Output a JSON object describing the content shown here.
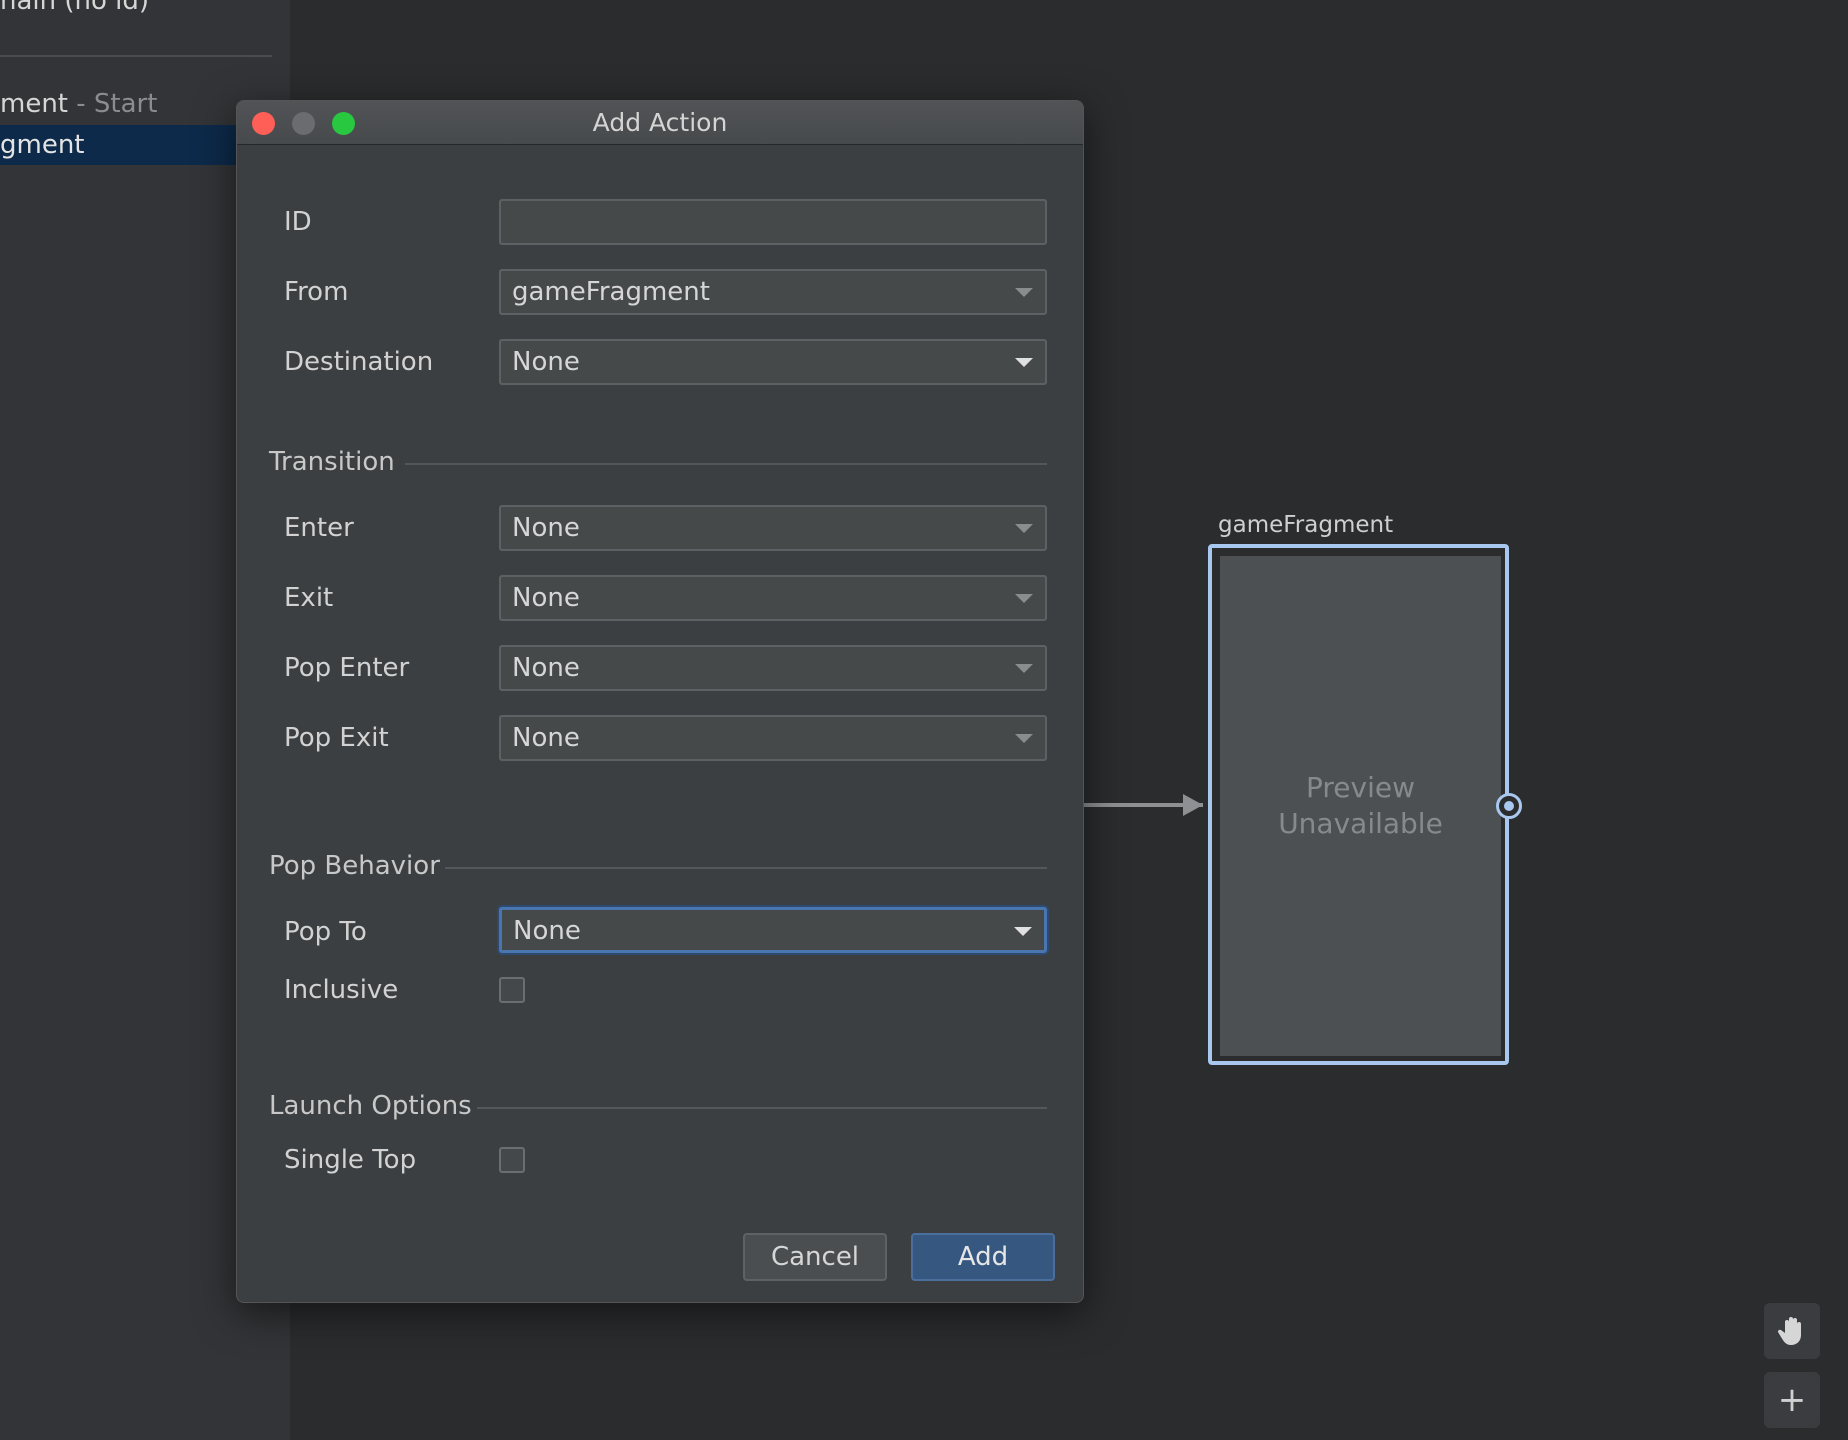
{
  "left_panel": {
    "root_item": "nain (no id)",
    "items": [
      {
        "label": "ment",
        "suffix": "- Start"
      },
      {
        "label": "gment",
        "selected": true
      }
    ]
  },
  "graph": {
    "node_label": "gameFragment",
    "preview_line1": "Preview",
    "preview_line2": "Unavailable"
  },
  "dialog": {
    "title": "Add Action",
    "fields": {
      "id": {
        "label": "ID",
        "value": ""
      },
      "from": {
        "label": "From",
        "value": "gameFragment"
      },
      "destination": {
        "label": "Destination",
        "value": "None"
      }
    },
    "transition": {
      "heading": "Transition",
      "enter": {
        "label": "Enter",
        "value": "None"
      },
      "exit": {
        "label": "Exit",
        "value": "None"
      },
      "pop_enter": {
        "label": "Pop Enter",
        "value": "None"
      },
      "pop_exit": {
        "label": "Pop Exit",
        "value": "None"
      }
    },
    "pop_behavior": {
      "heading": "Pop Behavior",
      "pop_to": {
        "label": "Pop To",
        "value": "None"
      },
      "inclusive": {
        "label": "Inclusive",
        "checked": false
      }
    },
    "launch_options": {
      "heading": "Launch Options",
      "single_top": {
        "label": "Single Top",
        "checked": false
      }
    },
    "buttons": {
      "cancel": "Cancel",
      "add": "Add"
    }
  },
  "tools": {
    "hand_icon": "hand-icon",
    "plus": "+"
  },
  "colors": {
    "accent": "#365880",
    "focus": "#4a76b0",
    "selection": "#a9c8f0"
  }
}
